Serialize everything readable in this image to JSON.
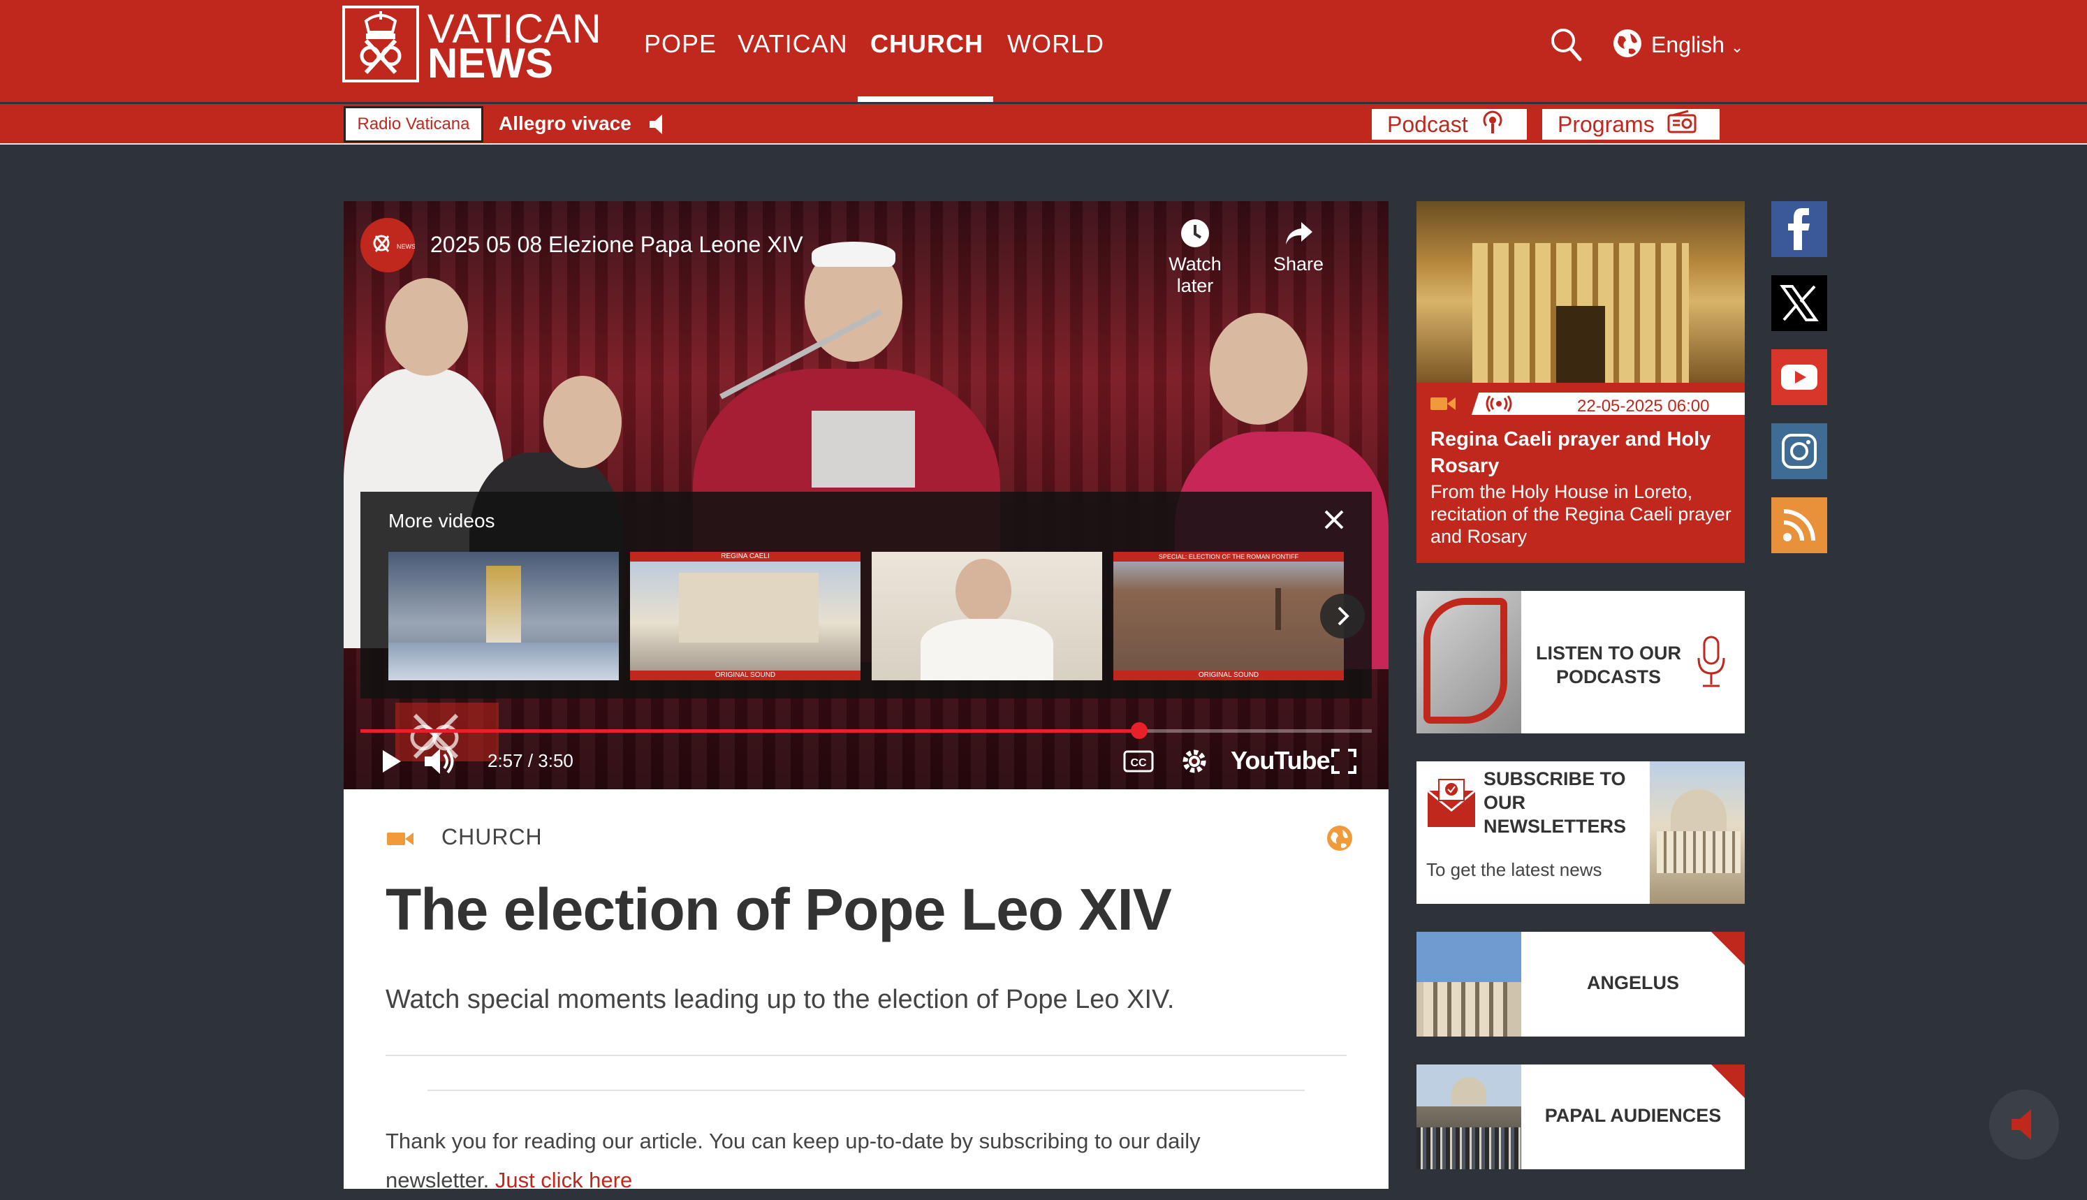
{
  "header": {
    "logo_line1": "VATICAN",
    "logo_line2": "NEWS",
    "nav": [
      "POPE",
      "VATICAN",
      "CHURCH",
      "WORLD"
    ],
    "active_nav": "CHURCH",
    "language": "English",
    "search_icon": "search-icon",
    "globe_icon": "globe-icon"
  },
  "subbar": {
    "radio_button": "Radio Vaticana",
    "now_playing": "Allegro vivace",
    "podcast": "Podcast",
    "programs": "Programs"
  },
  "video": {
    "title": "2025 05 08 Elezione Papa Leone XIV",
    "watch_later": "Watch later",
    "share": "Share",
    "more_videos": "More videos",
    "time": "2:57 / 3:50",
    "progress": 0.77,
    "youtube_label": "YouTube",
    "thumbs": [
      {
        "top_label": "",
        "bottom_label": ""
      },
      {
        "top_label": "REGINA CAELI",
        "bottom_label": "ORIGINAL SOUND"
      },
      {
        "top_label": "",
        "bottom_label": ""
      },
      {
        "top_label": "SPECIAL: ELECTION OF THE ROMAN PONTIFF",
        "bottom_label": "ORIGINAL SOUND"
      }
    ]
  },
  "article": {
    "category": "CHURCH",
    "title": "The election of Pope Leo XIV",
    "subtitle": "Watch special moments leading up to the election of Pope Leo XIV.",
    "footer_text": "Thank you for reading our article. You can keep up-to-date by subscribing to our daily",
    "footer_text2": "newsletter.",
    "footer_link": "Just click here"
  },
  "sidebar": {
    "live_date": "22-05-2025 06:00",
    "live_title": "Regina Caeli prayer and Holy Rosary",
    "live_desc": "From the Holy House in Loreto, recitation of the Regina Caeli prayer and Rosary",
    "podcasts": "LISTEN TO OUR PODCASTS",
    "newsletter_title": "SUBSCRIBE TO OUR NEWSLETTERS",
    "newsletter_sub": "To get the latest news",
    "angelus": "ANGELUS",
    "audiences": "PAPAL AUDIENCES"
  },
  "social": [
    "facebook-icon",
    "x-icon",
    "youtube-icon",
    "instagram-icon",
    "rss-icon"
  ],
  "colors": {
    "brand_red": "#c0271d",
    "accent_orange": "#f19a39",
    "page_bg": "#2e3339"
  }
}
